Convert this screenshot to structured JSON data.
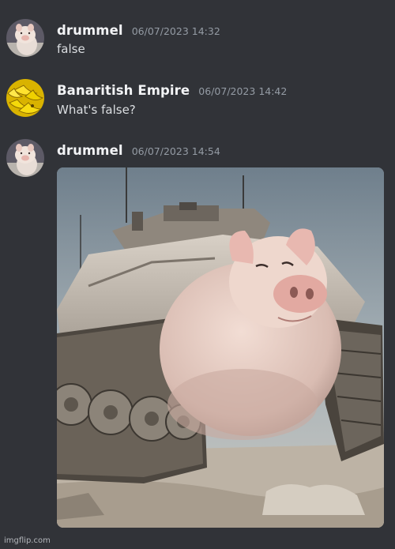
{
  "messages": [
    {
      "username": "drummel",
      "timestamp": "06/07/2023 14:32",
      "text": "false",
      "avatar": "pig-avatar-icon"
    },
    {
      "username": "Banaritish Empire",
      "timestamp": "06/07/2023 14:42",
      "text": "What's false?",
      "avatar": "banana-avatar-icon"
    },
    {
      "username": "drummel",
      "timestamp": "06/07/2023 14:54",
      "attachment": "pig-tank-image",
      "avatar": "pig-avatar-icon"
    }
  ],
  "watermark": "imgflip.com",
  "colors": {
    "background": "#313338",
    "username": "#f2f3f5",
    "timestamp": "#949ba4",
    "message_text": "#dbdee1"
  }
}
